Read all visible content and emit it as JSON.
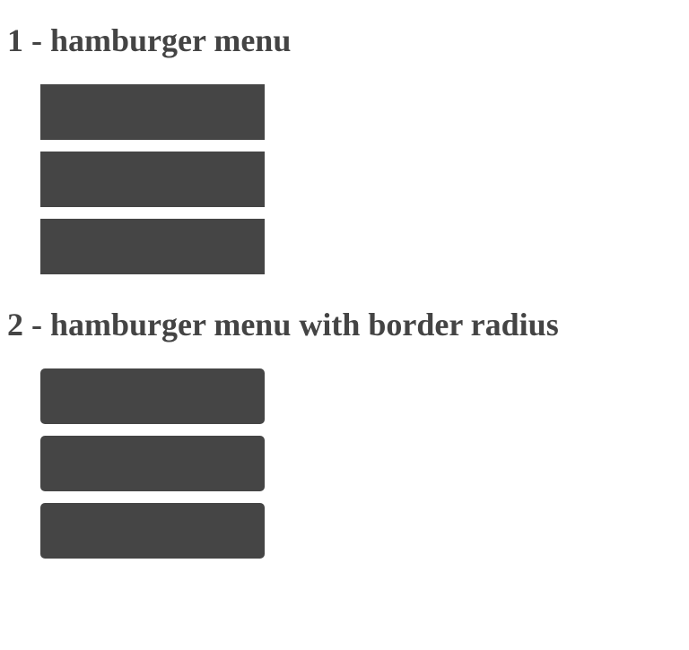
{
  "sections": [
    {
      "title": "1 - hamburger menu"
    },
    {
      "title": "2 - hamburger menu with border radius"
    }
  ],
  "colors": {
    "bar": "#454545",
    "heading": "#444444"
  }
}
